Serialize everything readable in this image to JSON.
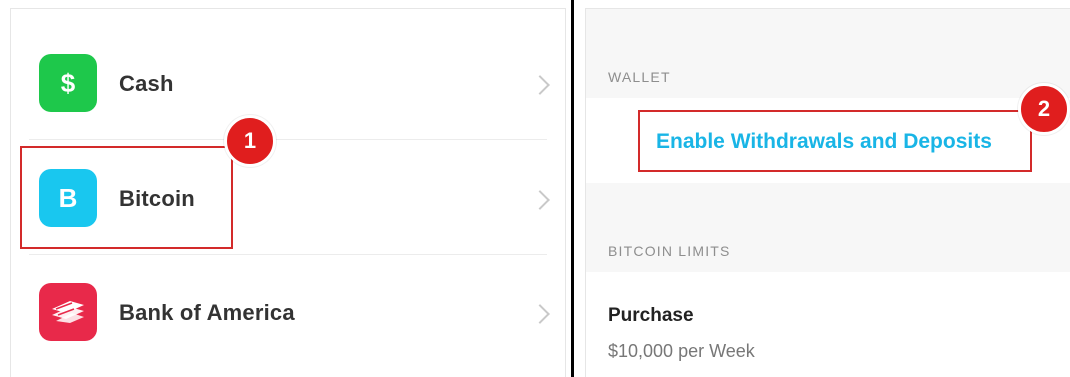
{
  "accounts": [
    {
      "label": "Cash",
      "icon": "dollar-icon",
      "glyph": "$",
      "color": "#1ec84b"
    },
    {
      "label": "Bitcoin",
      "icon": "bitcoin-icon",
      "glyph": "B",
      "color": "#19c7ef"
    },
    {
      "label": "Bank of America",
      "icon": "bank-of-america-logo-icon",
      "glyph": "",
      "color": "#e8294a"
    }
  ],
  "callouts": {
    "step1": "1",
    "step2": "2",
    "highlight_color": "#d32a2a",
    "badge_color": "#e01e1e"
  },
  "wallet": {
    "header": "WALLET",
    "enable_link": "Enable Withdrawals and Deposits",
    "link_color": "#19b5e6"
  },
  "limits": {
    "header": "BITCOIN LIMITS",
    "purchase_title": "Purchase",
    "purchase_value": "$10,000 per Week"
  }
}
